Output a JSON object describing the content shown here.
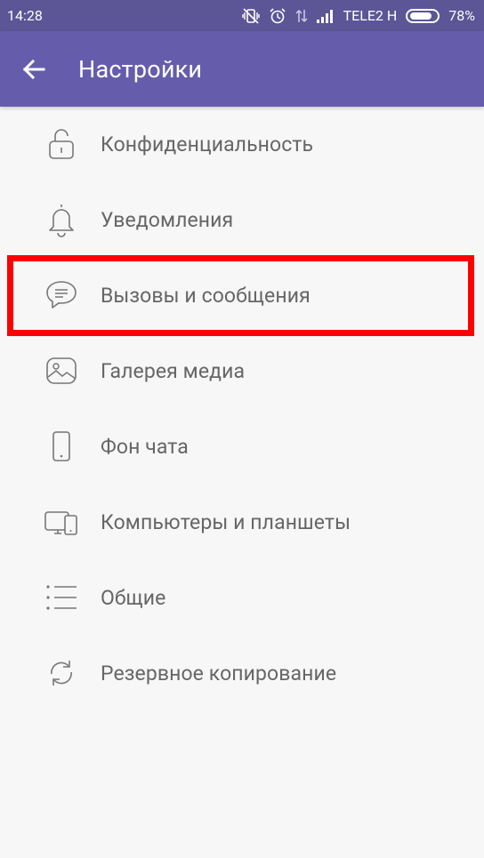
{
  "status": {
    "time": "14:28",
    "carrier": "TELE2 H",
    "battery": "78%",
    "icons": [
      "vibrate-off-icon",
      "alarm-icon",
      "data-arrows-icon",
      "signal-icon"
    ]
  },
  "appbar": {
    "title": "Настройки",
    "back_icon": "arrow-back-icon"
  },
  "settings": {
    "items": [
      {
        "label": "Конфиденциальность",
        "icon": "lock-icon"
      },
      {
        "label": "Уведомления",
        "icon": "bell-icon"
      },
      {
        "label": "Вызовы и сообщения",
        "icon": "chat-bubble-icon",
        "highlighted": true
      },
      {
        "label": "Галерея медиа",
        "icon": "gallery-icon"
      },
      {
        "label": "Фон чата",
        "icon": "phone-icon"
      },
      {
        "label": "Компьютеры и планшеты",
        "icon": "devices-icon"
      },
      {
        "label": "Общие",
        "icon": "list-icon"
      },
      {
        "label": "Резервное копирование",
        "icon": "sync-icon"
      }
    ]
  },
  "colors": {
    "statusbar": "#5c5596",
    "appbar": "#665cac",
    "background": "#f7f7f7",
    "highlight": "#ff0000"
  }
}
